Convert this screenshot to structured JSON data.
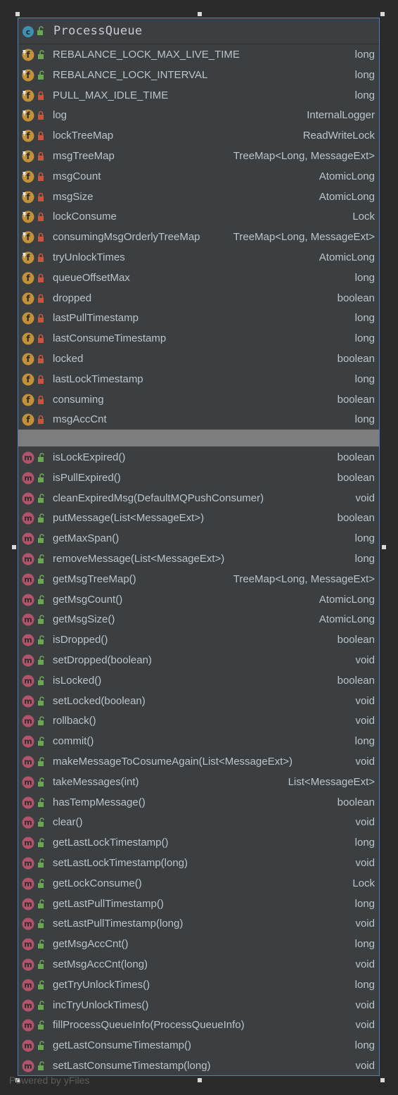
{
  "class_name": "ProcessQueue",
  "icons": {
    "class": "class-icon",
    "field": "field-icon",
    "method": "method-icon",
    "final_overlay": "pin-icon",
    "public": "unlocked-padlock-icon",
    "private": "locked-padlock-icon"
  },
  "colors": {
    "border": "#4f7fbf",
    "field_badge": "#c2913a",
    "method_badge": "#b1536a",
    "class_badge": "#3e8fb0",
    "public_lock": "#6aa84f",
    "private_lock": "#c7553f",
    "divider": "#7d7d7d"
  },
  "fields": [
    {
      "name": "REBALANCE_LOCK_MAX_LIVE_TIME",
      "type": "long",
      "final": true,
      "visibility": "public"
    },
    {
      "name": "REBALANCE_LOCK_INTERVAL",
      "type": "long",
      "final": true,
      "visibility": "public"
    },
    {
      "name": "PULL_MAX_IDLE_TIME",
      "type": "long",
      "final": true,
      "visibility": "private"
    },
    {
      "name": "log",
      "type": "InternalLogger",
      "final": true,
      "visibility": "private"
    },
    {
      "name": "lockTreeMap",
      "type": "ReadWriteLock",
      "final": true,
      "visibility": "private"
    },
    {
      "name": "msgTreeMap",
      "type": "TreeMap<Long, MessageExt>",
      "final": true,
      "visibility": "private"
    },
    {
      "name": "msgCount",
      "type": "AtomicLong",
      "final": true,
      "visibility": "private"
    },
    {
      "name": "msgSize",
      "type": "AtomicLong",
      "final": true,
      "visibility": "private"
    },
    {
      "name": "lockConsume",
      "type": "Lock",
      "final": true,
      "visibility": "private"
    },
    {
      "name": "consumingMsgOrderlyTreeMap",
      "type": "TreeMap<Long, MessageExt>",
      "final": true,
      "visibility": "private"
    },
    {
      "name": "tryUnlockTimes",
      "type": "AtomicLong",
      "final": true,
      "visibility": "private"
    },
    {
      "name": "queueOffsetMax",
      "type": "long",
      "final": false,
      "visibility": "private"
    },
    {
      "name": "dropped",
      "type": "boolean",
      "final": false,
      "visibility": "private"
    },
    {
      "name": "lastPullTimestamp",
      "type": "long",
      "final": false,
      "visibility": "private"
    },
    {
      "name": "lastConsumeTimestamp",
      "type": "long",
      "final": false,
      "visibility": "private"
    },
    {
      "name": "locked",
      "type": "boolean",
      "final": false,
      "visibility": "private"
    },
    {
      "name": "lastLockTimestamp",
      "type": "long",
      "final": false,
      "visibility": "private"
    },
    {
      "name": "consuming",
      "type": "boolean",
      "final": false,
      "visibility": "private"
    },
    {
      "name": "msgAccCnt",
      "type": "long",
      "final": false,
      "visibility": "private"
    }
  ],
  "methods": [
    {
      "name": "isLockExpired()",
      "type": "boolean"
    },
    {
      "name": "isPullExpired()",
      "type": "boolean"
    },
    {
      "name": "cleanExpiredMsg(DefaultMQPushConsumer)",
      "type": "void"
    },
    {
      "name": "putMessage(List<MessageExt>)",
      "type": "boolean"
    },
    {
      "name": "getMaxSpan()",
      "type": "long"
    },
    {
      "name": "removeMessage(List<MessageExt>)",
      "type": "long"
    },
    {
      "name": "getMsgTreeMap()",
      "type": "TreeMap<Long, MessageExt>"
    },
    {
      "name": "getMsgCount()",
      "type": "AtomicLong"
    },
    {
      "name": "getMsgSize()",
      "type": "AtomicLong"
    },
    {
      "name": "isDropped()",
      "type": "boolean"
    },
    {
      "name": "setDropped(boolean)",
      "type": "void"
    },
    {
      "name": "isLocked()",
      "type": "boolean"
    },
    {
      "name": "setLocked(boolean)",
      "type": "void"
    },
    {
      "name": "rollback()",
      "type": "void"
    },
    {
      "name": "commit()",
      "type": "long"
    },
    {
      "name": "makeMessageToCosumeAgain(List<MessageExt>)",
      "type": "void"
    },
    {
      "name": "takeMessages(int)",
      "type": "List<MessageExt>"
    },
    {
      "name": "hasTempMessage()",
      "type": "boolean"
    },
    {
      "name": "clear()",
      "type": "void"
    },
    {
      "name": "getLastLockTimestamp()",
      "type": "long"
    },
    {
      "name": "setLastLockTimestamp(long)",
      "type": "void"
    },
    {
      "name": "getLockConsume()",
      "type": "Lock"
    },
    {
      "name": "getLastPullTimestamp()",
      "type": "long"
    },
    {
      "name": "setLastPullTimestamp(long)",
      "type": "void"
    },
    {
      "name": "getMsgAccCnt()",
      "type": "long"
    },
    {
      "name": "setMsgAccCnt(long)",
      "type": "void"
    },
    {
      "name": "getTryUnlockTimes()",
      "type": "long"
    },
    {
      "name": "incTryUnlockTimes()",
      "type": "void"
    },
    {
      "name": "fillProcessQueueInfo(ProcessQueueInfo)",
      "type": "void"
    },
    {
      "name": "getLastConsumeTimestamp()",
      "type": "long"
    },
    {
      "name": "setLastConsumeTimestamp(long)",
      "type": "void"
    }
  ],
  "footer": "Powered by yFiles"
}
